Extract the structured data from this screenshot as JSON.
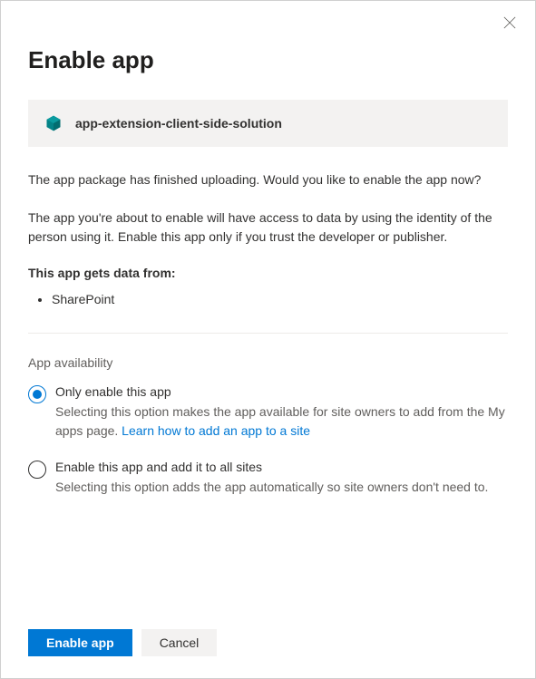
{
  "dialog": {
    "title": "Enable app",
    "app_name": "app-extension-client-side-solution",
    "description1": "The app package has finished uploading. Would you like to enable the app now?",
    "description2": "The app you're about to enable will have access to data by using the identity of the person using it. Enable this app only if you trust the developer or publisher.",
    "data_sources_label": "This app gets data from:",
    "data_sources": [
      "SharePoint"
    ],
    "availability": {
      "heading": "App availability",
      "options": [
        {
          "label": "Only enable this app",
          "hint": "Selecting this option makes the app available for site owners to add from the My apps page. ",
          "link_text": "Learn how to add an app to a site",
          "selected": true
        },
        {
          "label": "Enable this app and add it to all sites",
          "hint": "Selecting this option adds the app automatically so site owners don't need to.",
          "link_text": "",
          "selected": false
        }
      ]
    },
    "buttons": {
      "primary": "Enable app",
      "secondary": "Cancel"
    }
  }
}
